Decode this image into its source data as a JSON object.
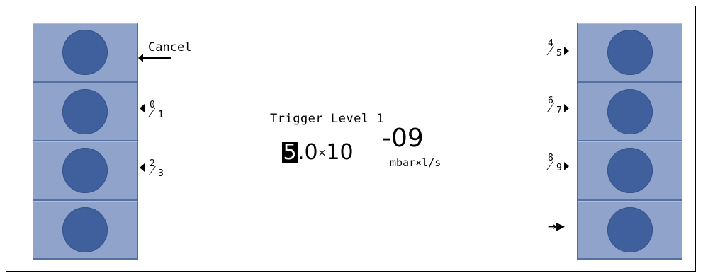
{
  "screen": {
    "title": "Trigger Level 1",
    "value": {
      "selected_digit": "5",
      "mantissa_rest": ".0",
      "times": "×",
      "base": "10",
      "exponent": "-09",
      "unit": "mbar×l/s"
    }
  },
  "softkeys": {
    "left": [
      {
        "label": "Cancel"
      },
      {
        "num": "0",
        "den": "1"
      },
      {
        "num": "2",
        "den": "3"
      },
      {
        "label": ""
      }
    ],
    "right": [
      {
        "num": "4",
        "den": "5"
      },
      {
        "num": "6",
        "den": "7"
      },
      {
        "num": "8",
        "den": "9"
      },
      {
        "label": "→▶"
      }
    ]
  },
  "colors": {
    "panel": "#8fa3cb",
    "button": "#3f5f9d",
    "border": "#4f6aa0"
  }
}
